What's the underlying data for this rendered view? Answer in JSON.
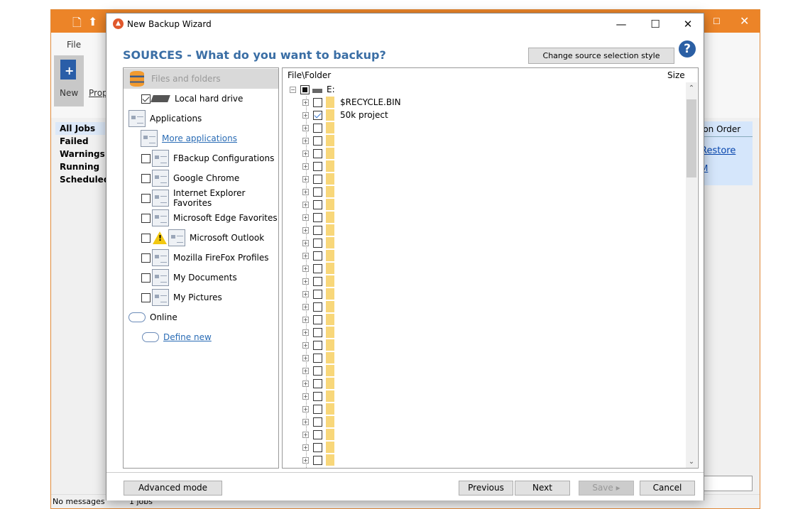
{
  "app": {
    "file_tab": "File",
    "new_label": "New",
    "prop_label": "Prop",
    "nav": [
      "All Jobs",
      "Failed",
      "Warnings",
      "Running",
      "Scheduled"
    ],
    "column_header": "ion Order",
    "restore_link": "Restore",
    "partial_link": "M",
    "status_messages": "No messages",
    "status_jobs": "1 jobs"
  },
  "dialog": {
    "title": "New Backup Wizard",
    "heading": "SOURCES - What do you want to backup?",
    "change_style": "Change source selection style",
    "help": "?",
    "sources": {
      "files_header": "Files and folders",
      "local_drive": "Local hard drive",
      "applications": "Applications",
      "more_apps": "More applications",
      "apps": [
        {
          "label": "FBackup Configurations",
          "checked": false
        },
        {
          "label": "Google Chrome",
          "checked": false
        },
        {
          "label": "Internet Explorer Favorites",
          "checked": false
        },
        {
          "label": "Microsoft Edge Favorites",
          "checked": false
        },
        {
          "label": "Microsoft Outlook",
          "checked": false,
          "warning": true
        },
        {
          "label": "Mozilla FireFox Profiles",
          "checked": false
        },
        {
          "label": "My Documents",
          "checked": false
        },
        {
          "label": "My Pictures",
          "checked": false
        }
      ],
      "online": "Online",
      "define_new": "Define new"
    },
    "tree": {
      "col_file": "File\\Folder",
      "col_size": "Size",
      "root": "E:",
      "items": [
        {
          "name": "$RECYCLE.BIN",
          "checked": false
        },
        {
          "name": "50k project",
          "checked": true
        }
      ],
      "unnamed_rows": 27
    },
    "buttons": {
      "advanced": "Advanced mode",
      "previous": "Previous",
      "next": "Next",
      "save": "Save",
      "cancel": "Cancel"
    }
  }
}
